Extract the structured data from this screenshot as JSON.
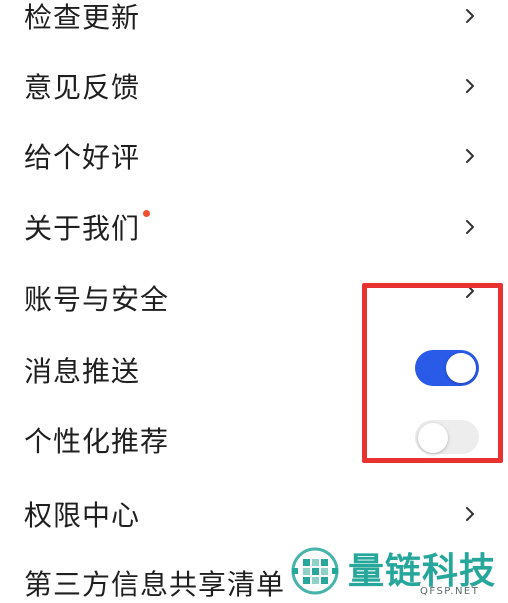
{
  "settings": {
    "items": [
      {
        "label": "检查更新",
        "control": "chevron"
      },
      {
        "label": "意见反馈",
        "control": "chevron"
      },
      {
        "label": "给个好评",
        "control": "chevron"
      },
      {
        "label": "关于我们",
        "control": "chevron",
        "badge": "red-dot"
      },
      {
        "label": "账号与安全",
        "control": "chevron"
      },
      {
        "label": "消息推送",
        "control": "toggle",
        "enabled": true
      },
      {
        "label": "个性化推荐",
        "control": "toggle",
        "enabled": false
      },
      {
        "label": "权限中心",
        "control": "chevron"
      },
      {
        "label": "第三方信息共享清单",
        "control": "none"
      }
    ]
  },
  "colors": {
    "toggle_on": "#2a5ae8",
    "toggle_off": "#ededed",
    "highlight_box": "#e8322f",
    "badge_dot": "#f0502e",
    "watermark": "#27a79c"
  },
  "watermark": {
    "title": "量链科技",
    "subtitle": "QFSP.NET"
  }
}
